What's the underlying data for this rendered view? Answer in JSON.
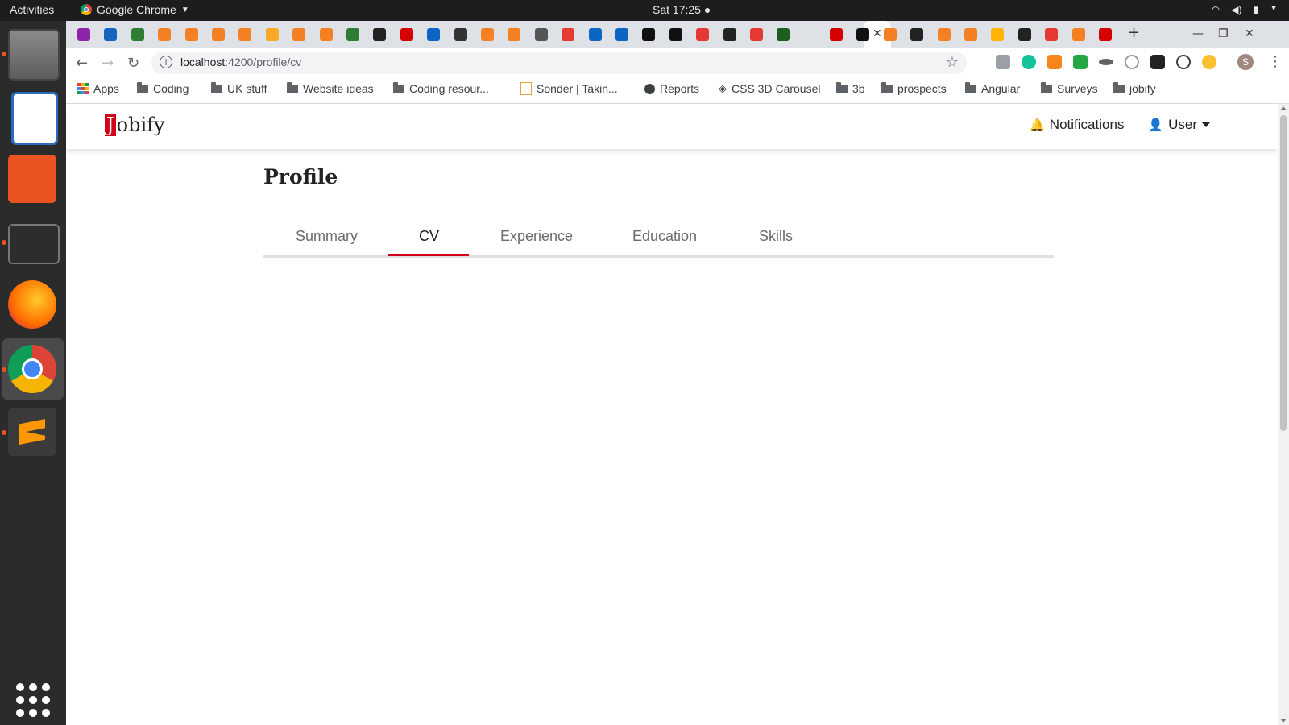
{
  "topbar": {
    "activities": "Activities",
    "app_name": "Google Chrome",
    "clock": "Sat 17:25 ●"
  },
  "dock": {
    "items": [
      "files-icon",
      "writer-icon",
      "software-center-icon",
      "terminal-icon",
      "firefox-icon",
      "chrome-icon",
      "sublime-icon"
    ]
  },
  "browser": {
    "url_host": "localhost",
    "url_path": ":4200/profile/cv",
    "avatar_letter": "S"
  },
  "bookmarks": [
    {
      "label": "Apps",
      "icon": "apps-icon"
    },
    {
      "label": "Coding",
      "icon": "folder-icon"
    },
    {
      "label": "UK stuff",
      "icon": "folder-icon"
    },
    {
      "label": "Website ideas",
      "icon": "folder-icon"
    },
    {
      "label": "Coding resour...",
      "icon": "folder-icon"
    },
    {
      "label": "Sonder | Takin...",
      "icon": "page-icon"
    },
    {
      "label": "Reports",
      "icon": "globe-icon"
    },
    {
      "label": "CSS 3D Carousel",
      "icon": "codepen-icon"
    },
    {
      "label": "3b",
      "icon": "folder-icon"
    },
    {
      "label": "prospects",
      "icon": "folder-icon"
    },
    {
      "label": "Angular",
      "icon": "folder-icon"
    },
    {
      "label": "Surveys",
      "icon": "folder-icon"
    },
    {
      "label": "jobify",
      "icon": "folder-icon"
    }
  ],
  "app": {
    "logo_initial": "J",
    "logo_rest": "obify",
    "nav": {
      "notifications": "Notifications",
      "user": "User"
    },
    "page_title": "Profile",
    "tabs": [
      {
        "label": "Summary",
        "active": false
      },
      {
        "label": "CV",
        "active": true
      },
      {
        "label": "Experience",
        "active": false
      },
      {
        "label": "Education",
        "active": false
      },
      {
        "label": "Skills",
        "active": false
      }
    ]
  },
  "colors": {
    "brand_red": "#d0021b",
    "ubuntu_orange": "#e95420"
  }
}
